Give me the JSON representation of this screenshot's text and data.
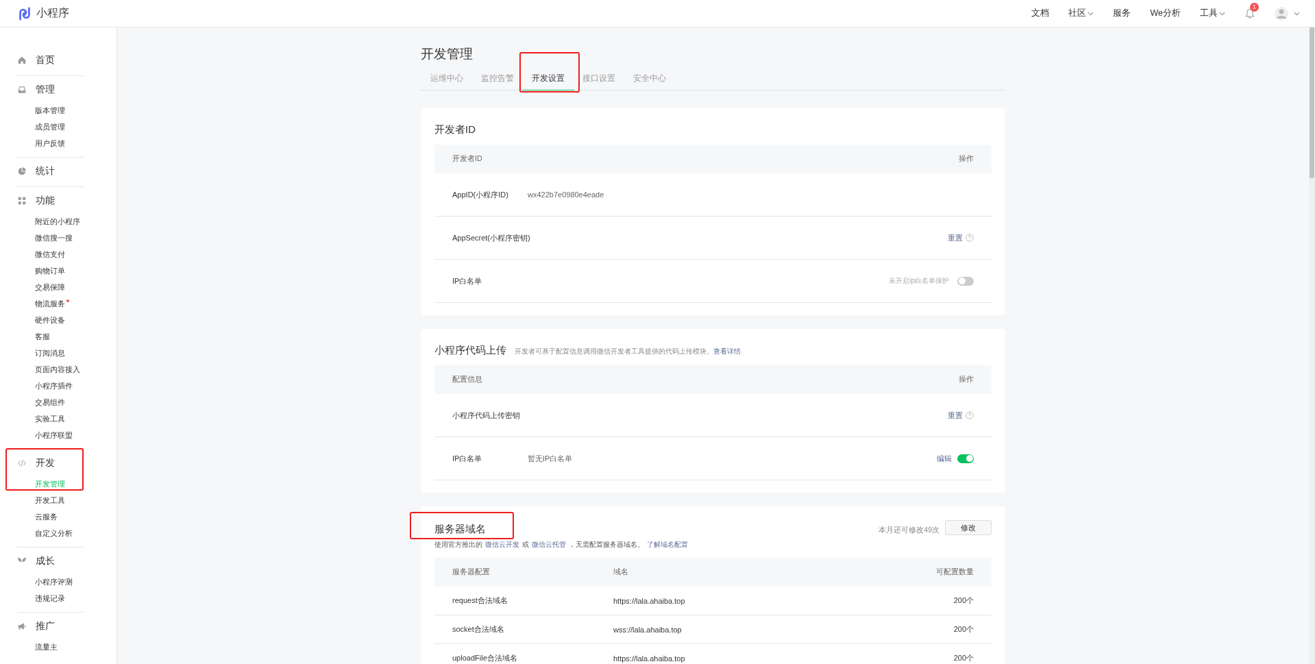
{
  "header": {
    "logo": "小程序",
    "links": [
      {
        "label": "文档",
        "dropdown": false
      },
      {
        "label": "社区",
        "dropdown": true
      },
      {
        "label": "服务",
        "dropdown": false
      },
      {
        "label": "We分析",
        "dropdown": false
      },
      {
        "label": "工具",
        "dropdown": true
      }
    ],
    "notifications": "1"
  },
  "sidebar": [
    {
      "label": "首页",
      "highlighted": false
    },
    {
      "label": "管理",
      "highlighted": false,
      "items": [
        {
          "label": "版本管理",
          "selected": false,
          "marked": false
        },
        {
          "label": "成员管理",
          "selected": false,
          "marked": false
        },
        {
          "label": "用户反馈",
          "selected": false,
          "marked": false
        }
      ]
    },
    {
      "label": "统计",
      "highlighted": false
    },
    {
      "label": "功能",
      "highlighted": false,
      "items": [
        {
          "label": "附近的小程序",
          "selected": false,
          "marked": false
        },
        {
          "label": "微信搜一搜",
          "selected": false,
          "marked": false
        },
        {
          "label": "微信支付",
          "selected": false,
          "marked": false
        },
        {
          "label": "购物订单",
          "selected": false,
          "marked": false
        },
        {
          "label": "交易保障",
          "selected": false,
          "marked": false
        },
        {
          "label": "物流服务",
          "selected": false,
          "marked": true
        },
        {
          "label": "硬件设备",
          "selected": false,
          "marked": false
        },
        {
          "label": "客服",
          "selected": false,
          "marked": false
        },
        {
          "label": "订阅消息",
          "selected": false,
          "marked": false
        },
        {
          "label": "页面内容接入",
          "selected": false,
          "marked": false
        },
        {
          "label": "小程序插件",
          "selected": false,
          "marked": false
        },
        {
          "label": "交易组件",
          "selected": false,
          "marked": false
        },
        {
          "label": "实验工具",
          "selected": false,
          "marked": false
        },
        {
          "label": "小程序联盟",
          "selected": false,
          "marked": false
        }
      ]
    },
    {
      "label": "开发",
      "highlighted": true,
      "items": [
        {
          "label": "开发管理",
          "selected": true,
          "marked": false
        },
        {
          "label": "开发工具",
          "selected": false,
          "marked": false
        },
        {
          "label": "云服务",
          "selected": false,
          "marked": false
        },
        {
          "label": "自定义分析",
          "selected": false,
          "marked": false
        }
      ]
    },
    {
      "label": "成长",
      "highlighted": false,
      "items": [
        {
          "label": "小程序评测",
          "selected": false,
          "marked": false
        },
        {
          "label": "违规记录",
          "selected": false,
          "marked": false
        }
      ]
    },
    {
      "label": "推广",
      "highlighted": false,
      "items": [
        {
          "label": "流量主",
          "selected": false,
          "marked": false
        }
      ]
    }
  ],
  "page_title": "开发管理",
  "tabs": [
    {
      "label": "运维中心",
      "selected": false,
      "highlighted": false
    },
    {
      "label": "监控告警",
      "selected": false,
      "highlighted": false
    },
    {
      "label": "开发设置",
      "selected": true,
      "highlighted": true
    },
    {
      "label": "接口设置",
      "selected": false,
      "highlighted": false
    },
    {
      "label": "安全中心",
      "selected": false,
      "highlighted": false
    }
  ],
  "developer_id": {
    "title": "开发者ID",
    "columns": [
      "开发者ID",
      "操作"
    ],
    "rows": [
      {
        "label": "AppID(小程序ID)",
        "value": "wx422b7e0980e4eade"
      },
      {
        "label": "AppSecret(小程序密钥)",
        "action": "重置",
        "help": true
      },
      {
        "label": "IP白名单",
        "note": "未开启ip白名单保护",
        "toggle": {
          "on": false
        }
      }
    ]
  },
  "code_upload": {
    "title": "小程序代码上传",
    "description": "开发者可基于配置信息调用微信开发者工具提供的代码上传模块。",
    "link": "查看详情",
    "columns": [
      "配置信息",
      "操作"
    ],
    "rows": [
      {
        "label": "小程序代码上传密钥",
        "action": "重置",
        "help": true
      },
      {
        "label": "IP白名单",
        "value": "暂无IP白名单",
        "action": "编辑",
        "toggle": {
          "on": true
        }
      }
    ]
  },
  "server_domain": {
    "title": "服务器域名",
    "highlighted": true,
    "description": [
      {
        "text": "使用官方推出的",
        "link": false
      },
      {
        "text": "微信云开发",
        "link": true
      },
      {
        "text": "或",
        "link": false
      },
      {
        "text": "微信云托管",
        "link": true
      },
      {
        "text": "，无需配置服务器域名。",
        "link": false
      },
      {
        "text": "了解域名配置",
        "link": true
      }
    ],
    "quota": "本月还可修改49次",
    "button": "修改",
    "columns": [
      "服务器配置",
      "域名",
      "可配置数量"
    ],
    "rows": [
      [
        "request合法域名",
        "https://lala.ahaiba.top",
        "200个"
      ],
      [
        "socket合法域名",
        "wss://lala.ahaiba.top",
        "200个"
      ],
      [
        "uploadFile合法域名",
        "https://lala.ahaiba.top",
        "200个"
      ]
    ]
  }
}
